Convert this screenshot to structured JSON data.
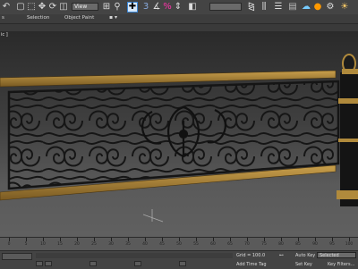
{
  "toolbar": {
    "view_dropdown": "View",
    "right_dropdown": ""
  },
  "menubar": {
    "items": [
      "Selection",
      "Object Paint"
    ],
    "left_label": "s"
  },
  "viewport": {
    "label": "ic ]"
  },
  "timeline": {
    "ticks": [
      "0",
      "5",
      "10",
      "15",
      "20",
      "25",
      "30",
      "35",
      "40",
      "45",
      "50",
      "55",
      "60",
      "65",
      "70",
      "75",
      "80",
      "85",
      "90",
      "95",
      "100"
    ]
  },
  "status": {
    "grid": "Grid = 100.0",
    "add_time_tag": "Add Time Tag",
    "auto_key": "Auto Key",
    "selected": "Selected",
    "set_key": "Set Key",
    "key_filters": "Key Filters..."
  },
  "colors": {
    "wood": "#b08a3c",
    "iron": "#1a1a1a",
    "accent_blue": "#3a86d6"
  }
}
